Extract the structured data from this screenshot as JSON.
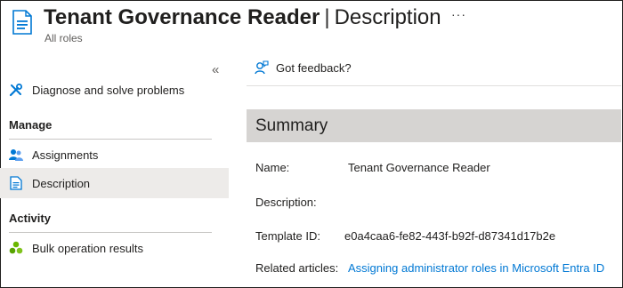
{
  "header": {
    "title_bold": "Tenant Governance Reader",
    "title_separator": "|",
    "title_section": "Description",
    "more_label": "···",
    "subtitle": "All roles"
  },
  "sidebar": {
    "collapse_glyph": "«",
    "items": [
      {
        "label": "Diagnose and solve problems",
        "icon": "wrench-icon"
      },
      {
        "label": "Assignments",
        "icon": "users-icon"
      },
      {
        "label": "Description",
        "icon": "document-icon",
        "selected": true
      },
      {
        "label": "Bulk operation results",
        "icon": "bulk-operation-icon"
      }
    ],
    "sections": {
      "manage": "Manage",
      "activity": "Activity"
    }
  },
  "main": {
    "feedback_label": "Got feedback?",
    "summary_title": "Summary",
    "fields": {
      "name_label": "Name:",
      "name_value": "Tenant Governance Reader",
      "description_label": "Description:",
      "template_label": "Template ID:",
      "template_value": "e0a4caa6-fe82-443f-b92f-d87341d17b2e",
      "articles_label": "Related articles:",
      "articles_value": "Assigning administrator roles in Microsoft Entra ID"
    }
  },
  "colors": {
    "accent": "#0078d4",
    "selected_bg": "#edebe9",
    "summary_bg": "#d6d4d2"
  }
}
